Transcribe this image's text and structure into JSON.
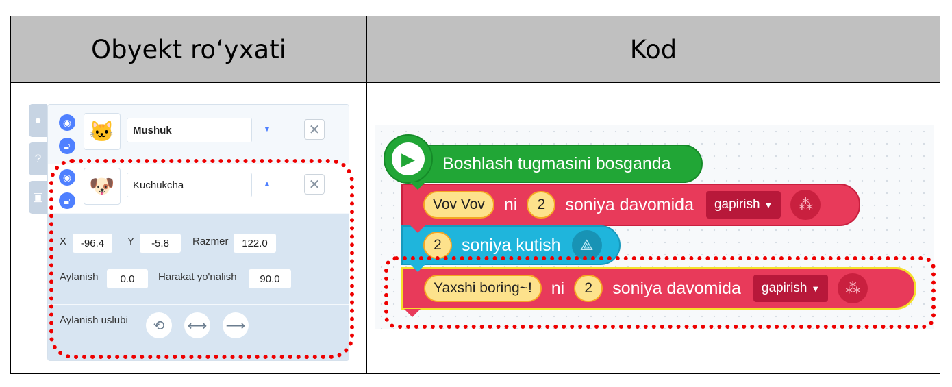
{
  "table": {
    "header_left": "Obyekt ro‘yxati",
    "header_right": "Kod"
  },
  "objects": [
    {
      "name": "Mushuk",
      "thumb_icon": "cat-icon",
      "visible_icon": "eye-icon",
      "lock_icon": "unlock-icon",
      "expanded": false
    },
    {
      "name": "Kuchukcha",
      "thumb_icon": "dog-icon",
      "visible_icon": "eye-icon",
      "lock_icon": "unlock-icon",
      "expanded": true
    }
  ],
  "side_tabs": [
    "shapes-icon",
    "help-icon",
    "console-icon"
  ],
  "help_glyph": "?",
  "props": {
    "x_label": "X",
    "x_value": "-96.4",
    "y_label": "Y",
    "y_value": "-5.8",
    "size_label": "Razmer",
    "size_value": "122.0",
    "rotation_label": "Aylanish",
    "rotation_value": "0.0",
    "direction_label": "Harakat yo'nalish",
    "direction_value": "90.0",
    "rotation_style_label": "Aylanish uslubi",
    "rotation_styles": [
      "rotate-free-icon",
      "flip-horizontal-icon",
      "no-rotate-icon"
    ]
  },
  "code": {
    "start_block": "Boshlash tugmasini bosganda",
    "say_block_1": {
      "text": "Vov Vov",
      "ni": "ni",
      "seconds": "2",
      "middle": "soniya davomida",
      "action": "gapirish"
    },
    "wait_block": {
      "seconds": "2",
      "label": "soniya kutish"
    },
    "say_block_2": {
      "text": "Yaxshi boring~!",
      "ni": "ni",
      "seconds": "2",
      "middle": "soniya davomida",
      "action": "gapirish"
    }
  },
  "colors": {
    "start_block": "#21a636",
    "looks_block": "#e83a5a",
    "flow_block": "#1fb5dc",
    "highlight": "#ee0000"
  }
}
